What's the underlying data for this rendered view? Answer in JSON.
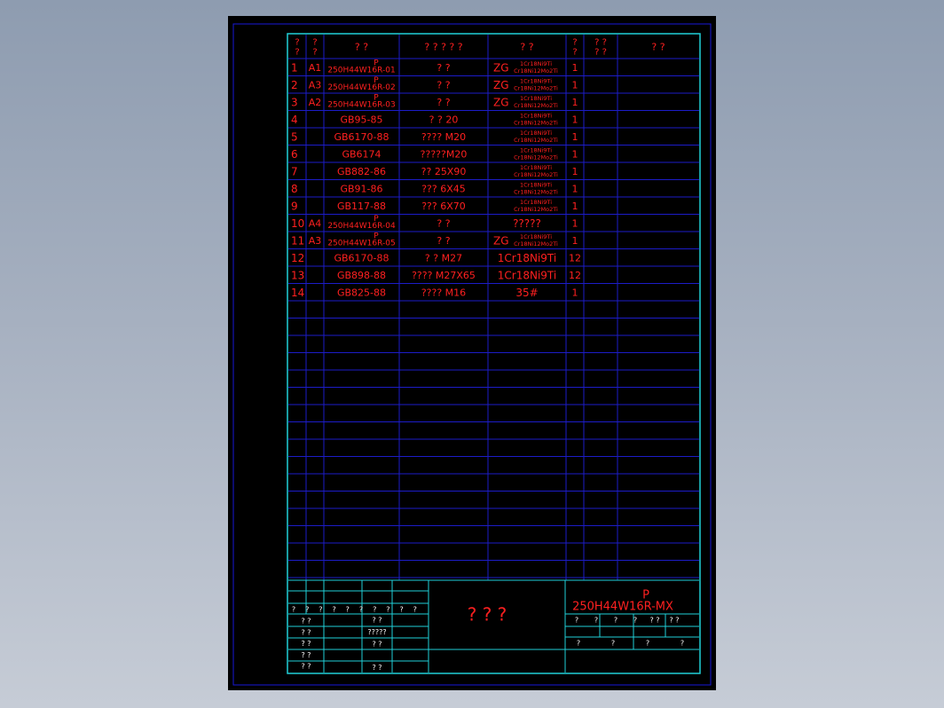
{
  "colors": {
    "paper": "#000000",
    "border_outer": "#1818d8",
    "frame": "#20d0d8",
    "grid": "#1c1cc8",
    "text_red": "#ff2020",
    "text_white": "#ffffff"
  },
  "table": {
    "header": [
      "? ?",
      "? ?",
      "?   ?",
      "? ? ? ? ?",
      "?   ?",
      "? ?",
      "? ? ? ?",
      "?   ?"
    ],
    "rows": [
      {
        "no": "1",
        "code": "A1",
        "drawing_top": "P",
        "drawing": "250H44W16R-01",
        "name": "?   ?",
        "mat_prefix": "ZG",
        "mat_top": "1Cr18Ni9Ti",
        "mat_bot": "Cr18Ni12Mo2Ti",
        "material": "",
        "qty": "1"
      },
      {
        "no": "2",
        "code": "A3",
        "drawing_top": "P",
        "drawing": "250H44W16R-02",
        "name": "?   ?",
        "mat_prefix": "ZG",
        "mat_top": "1Cr18Ni9Ti",
        "mat_bot": "Cr18Ni12Mo2Ti",
        "material": "",
        "qty": "1"
      },
      {
        "no": "3",
        "code": "A2",
        "drawing_top": "P",
        "drawing": "250H44W16R-03",
        "name": "?   ?",
        "mat_prefix": "ZG",
        "mat_top": "1Cr18Ni9Ti",
        "mat_bot": "Cr18Ni12Mo2Ti",
        "material": "",
        "qty": "1"
      },
      {
        "no": "4",
        "code": "",
        "drawing_top": "",
        "drawing": "GB95-85",
        "name": "?  ? 20",
        "mat_prefix": "",
        "mat_top": "1Cr18Ni9Ti",
        "mat_bot": "Cr18Ni12Mo2Ti",
        "material": "",
        "qty": "1"
      },
      {
        "no": "5",
        "code": "",
        "drawing_top": "",
        "drawing": "GB6170-88",
        "name": "???? M20",
        "mat_prefix": "",
        "mat_top": "1Cr18Ni9Ti",
        "mat_bot": "Cr18Ni12Mo2Ti",
        "material": "",
        "qty": "1"
      },
      {
        "no": "6",
        "code": "",
        "drawing_top": "",
        "drawing": "GB6174",
        "name": "?????M20",
        "mat_prefix": "",
        "mat_top": "1Cr18Ni9Ti",
        "mat_bot": "Cr18Ni12Mo2Ti",
        "material": "",
        "qty": "1"
      },
      {
        "no": "7",
        "code": "",
        "drawing_top": "",
        "drawing": "GB882-86",
        "name": "?? 25X90",
        "mat_prefix": "",
        "mat_top": "1Cr18Ni9Ti",
        "mat_bot": "Cr18Ni12Mo2Ti",
        "material": "",
        "qty": "1"
      },
      {
        "no": "8",
        "code": "",
        "drawing_top": "",
        "drawing": "GB91-86",
        "name": "??? 6X45",
        "mat_prefix": "",
        "mat_top": "1Cr18Ni9Ti",
        "mat_bot": "Cr18Ni12Mo2Ti",
        "material": "",
        "qty": "1"
      },
      {
        "no": "9",
        "code": "",
        "drawing_top": "",
        "drawing": "GB117-88",
        "name": "??? 6X70",
        "mat_prefix": "",
        "mat_top": "1Cr18Ni9Ti",
        "mat_bot": "Cr18Ni12Mo2Ti",
        "material": "",
        "qty": "1"
      },
      {
        "no": "10",
        "code": "A4",
        "drawing_top": "P",
        "drawing": "250H44W16R-04",
        "name": "?   ?",
        "mat_prefix": "",
        "mat_top": "",
        "mat_bot": "",
        "material": "?????",
        "qty": "1"
      },
      {
        "no": "11",
        "code": "A3",
        "drawing_top": "P",
        "drawing": "250H44W16R-05",
        "name": "?   ?",
        "mat_prefix": "ZG",
        "mat_top": "1Cr18Ni9Ti",
        "mat_bot": "Cr18Ni12Mo2Ti",
        "material": "",
        "qty": "1"
      },
      {
        "no": "12",
        "code": "",
        "drawing_top": "",
        "drawing": "GB6170-88",
        "name": "?   ? M27",
        "mat_prefix": "",
        "mat_top": "",
        "mat_bot": "",
        "material": "1Cr18Ni9Ti",
        "qty": "12"
      },
      {
        "no": "13",
        "code": "",
        "drawing_top": "",
        "drawing": "GB898-88",
        "name": "???? M27X65",
        "mat_prefix": "",
        "mat_top": "",
        "mat_bot": "",
        "material": "1Cr18Ni9Ti",
        "qty": "12"
      },
      {
        "no": "14",
        "code": "",
        "drawing_top": "",
        "drawing": "GB825-88",
        "name": "???? M16",
        "mat_prefix": "",
        "mat_top": "",
        "mat_bot": "",
        "material": "35#",
        "qty": "1"
      }
    ]
  },
  "title_block": {
    "revision_header": [
      "?",
      "?",
      "?",
      "?",
      "?",
      "?",
      "?",
      "?",
      "?",
      "?"
    ],
    "sign_labels_left": [
      "?  ?",
      "?  ?",
      "?  ?",
      "?  ?",
      "?  ?"
    ],
    "sign_labels_mid": [
      "?  ?",
      "?????",
      "?  ?",
      "?  ?"
    ],
    "center_title": "?   ?   ?",
    "drawing_no_top": "P",
    "drawing_no": "250H44W16R-MX",
    "right_header": [
      "?",
      "?",
      "?",
      "?",
      "?  ?",
      "?  ?"
    ],
    "right_footer": [
      "?",
      "?",
      "?",
      "?"
    ]
  }
}
